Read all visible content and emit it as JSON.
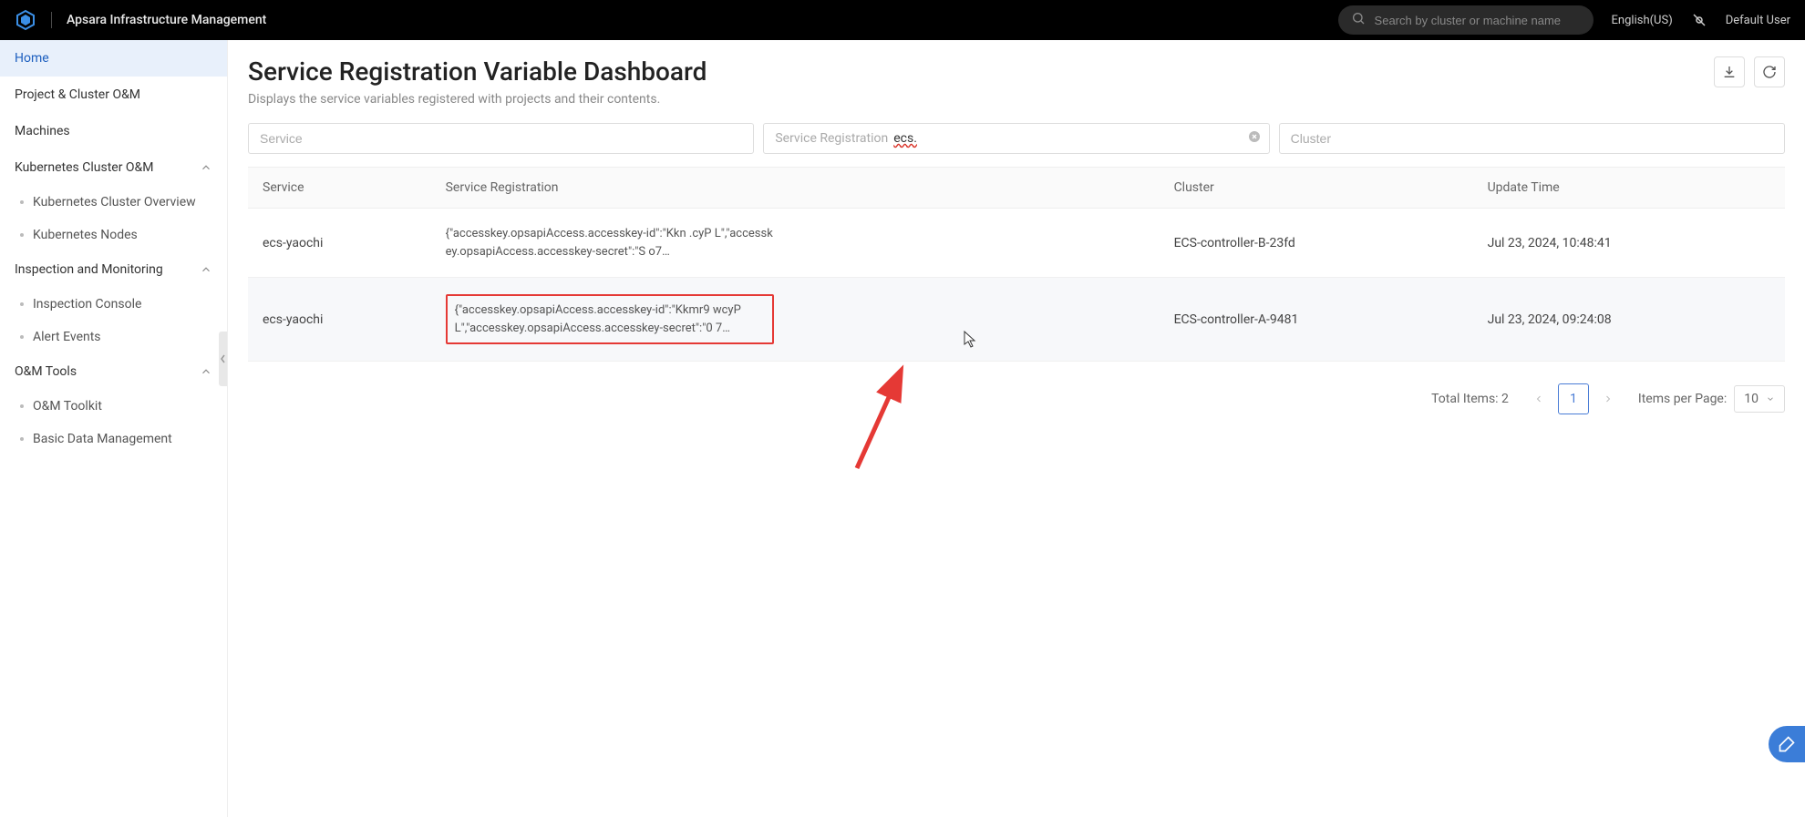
{
  "header": {
    "app_title": "Apsara Infrastructure Management",
    "search_placeholder": "Search by cluster or machine name",
    "language": "English(US)",
    "user": "Default User"
  },
  "sidebar": {
    "items": [
      {
        "label": "Home",
        "active": true
      },
      {
        "label": "Project & Cluster O&M"
      },
      {
        "label": "Machines"
      },
      {
        "label": "Kubernetes Cluster O&M",
        "expandable": true,
        "children": [
          {
            "label": "Kubernetes Cluster Overview"
          },
          {
            "label": "Kubernetes Nodes"
          }
        ]
      },
      {
        "label": "Inspection and Monitoring",
        "expandable": true,
        "children": [
          {
            "label": "Inspection Console"
          },
          {
            "label": "Alert Events"
          }
        ]
      },
      {
        "label": "O&M Tools",
        "expandable": true,
        "children": [
          {
            "label": "O&M Toolkit"
          },
          {
            "label": "Basic Data Management"
          }
        ]
      }
    ]
  },
  "page": {
    "title": "Service Registration Variable Dashboard",
    "subtitle": "Displays the service variables registered with projects and their contents."
  },
  "filters": {
    "service_placeholder": "Service",
    "registration_prefix": "Service Registration",
    "registration_value": "ecs.",
    "cluster_placeholder": "Cluster"
  },
  "table": {
    "columns": [
      "Service",
      "Service Registration",
      "Cluster",
      "Update Time"
    ],
    "rows": [
      {
        "service": "ecs-yaochi",
        "registration": "{\"accesskey.opsapiAccess.accesskey-id\":\"Kkn        .cyP L\",\"accesskey.opsapiAccess.accesskey-secret\":\"S        o7…",
        "cluster": "ECS-controller-B-23fd",
        "update_time": "Jul 23, 2024, 10:48:41"
      },
      {
        "service": "ecs-yaochi",
        "registration": "{\"accesskey.opsapiAccess.accesskey-id\":\"Kkmr9      wcyP L\",\"accesskey.opsapiAccess.accesskey-secret\":\"0      7…",
        "cluster": "ECS-controller-A-9481",
        "update_time": "Jul 23, 2024, 09:24:08"
      }
    ]
  },
  "pagination": {
    "total_label": "Total Items: 2",
    "current_page": "1",
    "per_page_label": "Items per Page:",
    "per_page_value": "10"
  }
}
